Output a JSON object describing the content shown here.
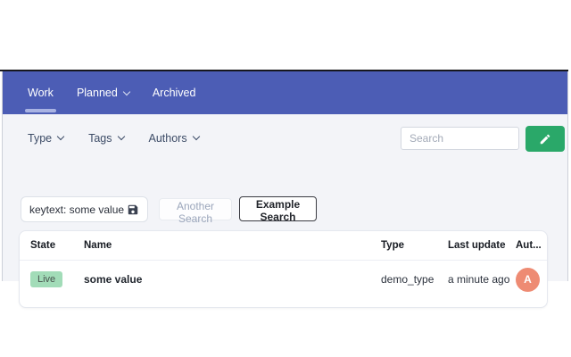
{
  "nav": {
    "tabs": [
      {
        "label": "Work",
        "active": true
      },
      {
        "label": "Planned",
        "has_dropdown": true
      },
      {
        "label": "Archived",
        "active": false
      }
    ]
  },
  "filters": {
    "dropdowns": [
      {
        "label": "Type"
      },
      {
        "label": "Tags"
      },
      {
        "label": "Authors"
      }
    ],
    "search": {
      "value": "",
      "placeholder": "Search"
    },
    "edit_button": {
      "icon": "pencil-icon"
    }
  },
  "saved_searches": {
    "keytext_chip": {
      "value": "keytext: some value",
      "icon": "save-icon"
    },
    "buttons": [
      {
        "label": "Another Search",
        "style": "muted"
      },
      {
        "label": "Example Search",
        "style": "outlined"
      }
    ]
  },
  "table": {
    "columns": [
      "State",
      "Name",
      "Type",
      "Last update",
      "Aut..."
    ],
    "rows": [
      {
        "state": "Live",
        "name": "some value",
        "type": "demo_type",
        "last_update": "a minute ago",
        "author_initial": "A"
      }
    ]
  },
  "colors": {
    "nav_blue": "#4c5db5",
    "active_tab_underline": "#a9b3e3",
    "top_border": "#17171e",
    "content_background": "#f3f4f8",
    "edit_button_green": "#2aa869",
    "live_badge_background": "#a2dcb8",
    "avatar_coral": "#ee8b73"
  }
}
